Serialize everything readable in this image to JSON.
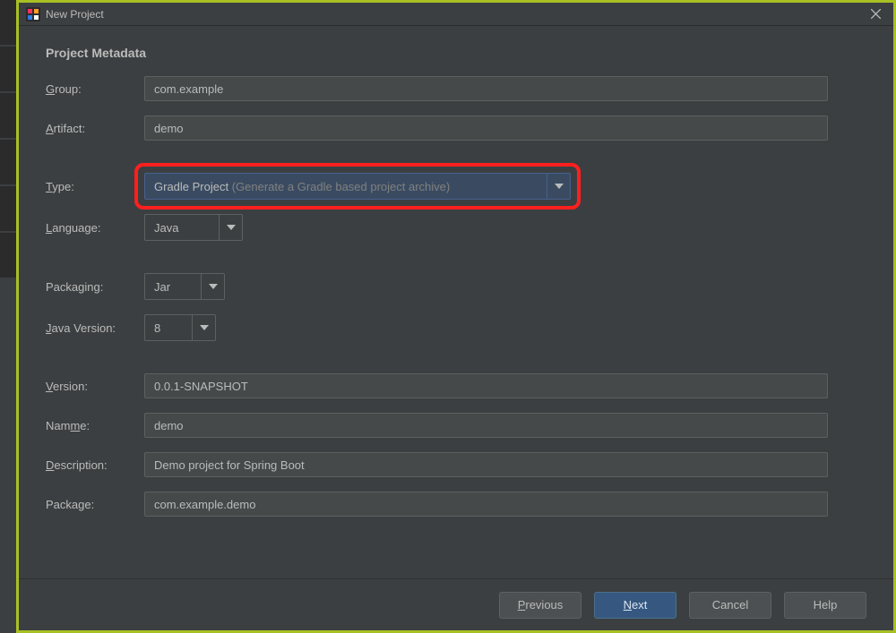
{
  "window": {
    "title": "New Project"
  },
  "section": {
    "title": "Project Metadata"
  },
  "labels": {
    "group": "roup:",
    "artifact": "rtifact:",
    "type": "ype:",
    "language": "anguage:",
    "packaging": "Packaging:",
    "javaVersion": "ava Version:",
    "version": "ersion:",
    "name": "e:",
    "description": "escription:",
    "package": "Packa"
  },
  "labelPrefixes": {
    "group": "G",
    "artifact": "A",
    "type": "T",
    "language": "L",
    "javaVersion": "J",
    "version": "V",
    "name": "Nam",
    "description": "D",
    "packageSuffix": "e:",
    "packageUnder": "g"
  },
  "fields": {
    "group": "com.example",
    "artifact": "demo",
    "type": "Gradle Project",
    "typeHint": "(Generate a Gradle based project archive)",
    "language": "Java",
    "packaging": "Jar",
    "javaVersion": "8",
    "version": "0.0.1-SNAPSHOT",
    "name": "demo",
    "description": "Demo project for Spring Boot",
    "package": "com.example.demo"
  },
  "buttons": {
    "previous": "revious",
    "previousU": "P",
    "next": "ext",
    "nextU": "N",
    "cancel": "Cancel",
    "help": "Help"
  }
}
